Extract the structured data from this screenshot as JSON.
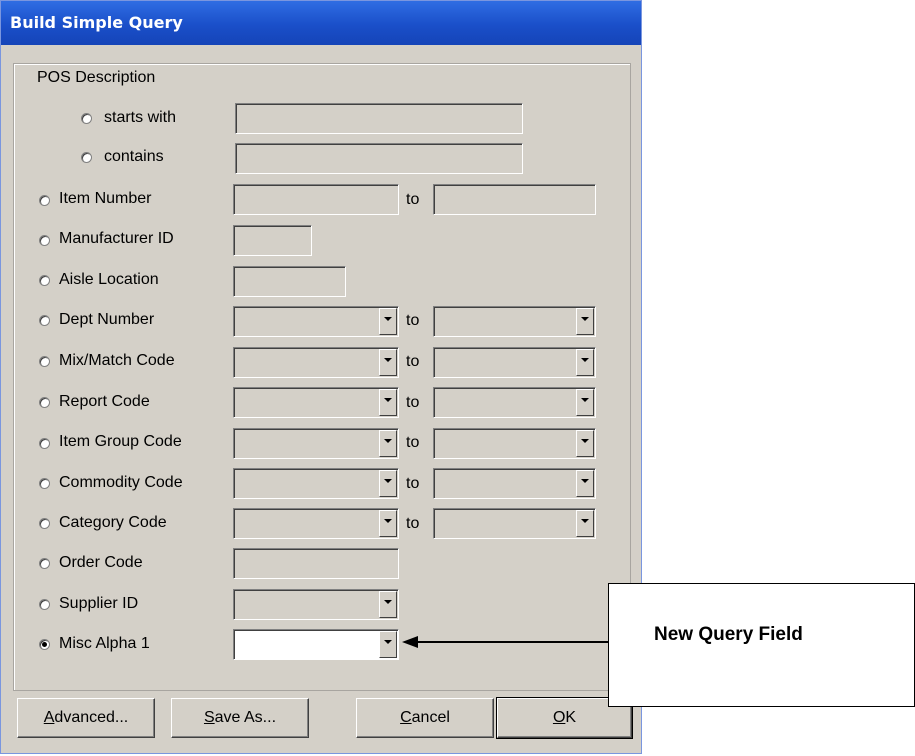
{
  "window": {
    "title": "Build Simple Query"
  },
  "group_label": "POS Description",
  "desc_options": [
    {
      "label": "starts with",
      "value": ""
    },
    {
      "label": "contains",
      "value": ""
    }
  ],
  "rows": [
    {
      "label": "Item Number",
      "type": "range-text",
      "from": "",
      "to_label": "to",
      "to": ""
    },
    {
      "label": "Manufacturer ID",
      "type": "text",
      "value": ""
    },
    {
      "label": "Aisle Location",
      "type": "text",
      "value": ""
    },
    {
      "label": "Dept Number",
      "type": "range-select",
      "from": "",
      "to_label": "to",
      "to": ""
    },
    {
      "label": "Mix/Match Code",
      "type": "range-select",
      "from": "",
      "to_label": "to",
      "to": ""
    },
    {
      "label": "Report Code",
      "type": "range-select",
      "from": "",
      "to_label": "to",
      "to": ""
    },
    {
      "label": "Item Group Code",
      "type": "range-select",
      "from": "",
      "to_label": "to",
      "to": ""
    },
    {
      "label": "Commodity Code",
      "type": "range-select",
      "from": "",
      "to_label": "to",
      "to": ""
    },
    {
      "label": "Category Code",
      "type": "range-select",
      "from": "",
      "to_label": "to",
      "to": ""
    },
    {
      "label": "Order Code",
      "type": "text",
      "value": ""
    },
    {
      "label": "Supplier ID",
      "type": "select",
      "value": ""
    },
    {
      "label": "Misc Alpha 1",
      "type": "select",
      "value": "",
      "selected": true
    }
  ],
  "buttons": {
    "advanced": "Advanced...",
    "save_as": "Save As...",
    "cancel": "Cancel",
    "ok": "OK"
  },
  "callout": {
    "text": "New Query Field"
  },
  "colors": {
    "title_bar": "#1a4fc9",
    "dialog_face": "#d4d0c8"
  }
}
